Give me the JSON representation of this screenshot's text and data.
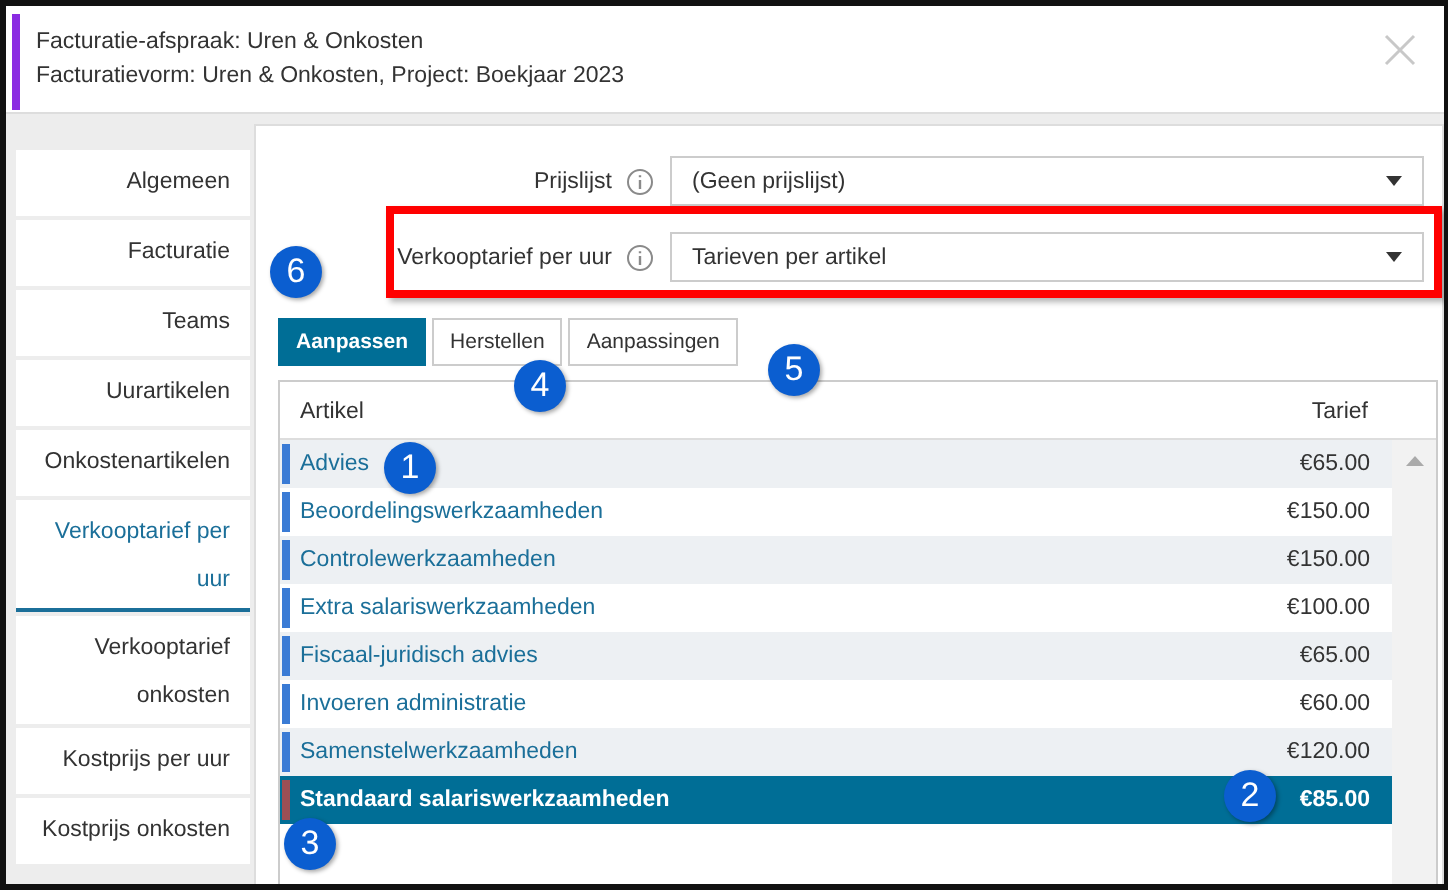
{
  "header": {
    "title": "Facturatie-afspraak: Uren & Onkosten",
    "subtitle": "Facturatievorm: Uren & Onkosten, Project: Boekjaar 2023"
  },
  "sidebar": {
    "items": [
      {
        "label": "Algemeen",
        "selected": false
      },
      {
        "label": "Facturatie",
        "selected": false
      },
      {
        "label": "Teams",
        "selected": false
      },
      {
        "label": "Uurartikelen",
        "selected": false
      },
      {
        "label": "Onkostenartikelen",
        "selected": false
      },
      {
        "label": "Verkooptarief per uur",
        "selected": true
      },
      {
        "label": "Verkooptarief onkosten",
        "selected": false
      },
      {
        "label": "Kostprijs per uur",
        "selected": false
      },
      {
        "label": "Kostprijs onkosten",
        "selected": false
      }
    ]
  },
  "form": {
    "fields": [
      {
        "label": "Prijslijst",
        "value": "(Geen prijslijst)",
        "highlighted": false
      },
      {
        "label": "Verkooptarief per uur",
        "value": "Tarieven per artikel",
        "highlighted": true
      }
    ]
  },
  "buttons": [
    {
      "label": "Aanpassen",
      "selected": true
    },
    {
      "label": "Herstellen",
      "selected": false
    },
    {
      "label": "Aanpassingen",
      "selected": false
    }
  ],
  "table": {
    "columns": [
      "Artikel",
      "Tarief"
    ],
    "rows": [
      {
        "artikel": "Advies",
        "tarief": "€65.00",
        "selected": false,
        "color": "#3a7bd5"
      },
      {
        "artikel": "Beoordelingswerkzaamheden",
        "tarief": "€150.00",
        "selected": false,
        "color": "#3a7bd5"
      },
      {
        "artikel": "Controlewerkzaamheden",
        "tarief": "€150.00",
        "selected": false,
        "color": "#3a7bd5"
      },
      {
        "artikel": "Extra salariswerkzaamheden",
        "tarief": "€100.00",
        "selected": false,
        "color": "#3a7bd5"
      },
      {
        "artikel": "Fiscaal-juridisch advies",
        "tarief": "€65.00",
        "selected": false,
        "color": "#3a7bd5"
      },
      {
        "artikel": "Invoeren administratie",
        "tarief": "€60.00",
        "selected": false,
        "color": "#3a7bd5"
      },
      {
        "artikel": "Samenstelwerkzaamheden",
        "tarief": "€120.00",
        "selected": false,
        "color": "#3a7bd5"
      },
      {
        "artikel": "Standaard salariswerkzaamheden",
        "tarief": "€85.00",
        "selected": true,
        "color": "#9b4f55"
      }
    ]
  },
  "annotations": [
    "1",
    "2",
    "3",
    "4",
    "5",
    "6"
  ]
}
